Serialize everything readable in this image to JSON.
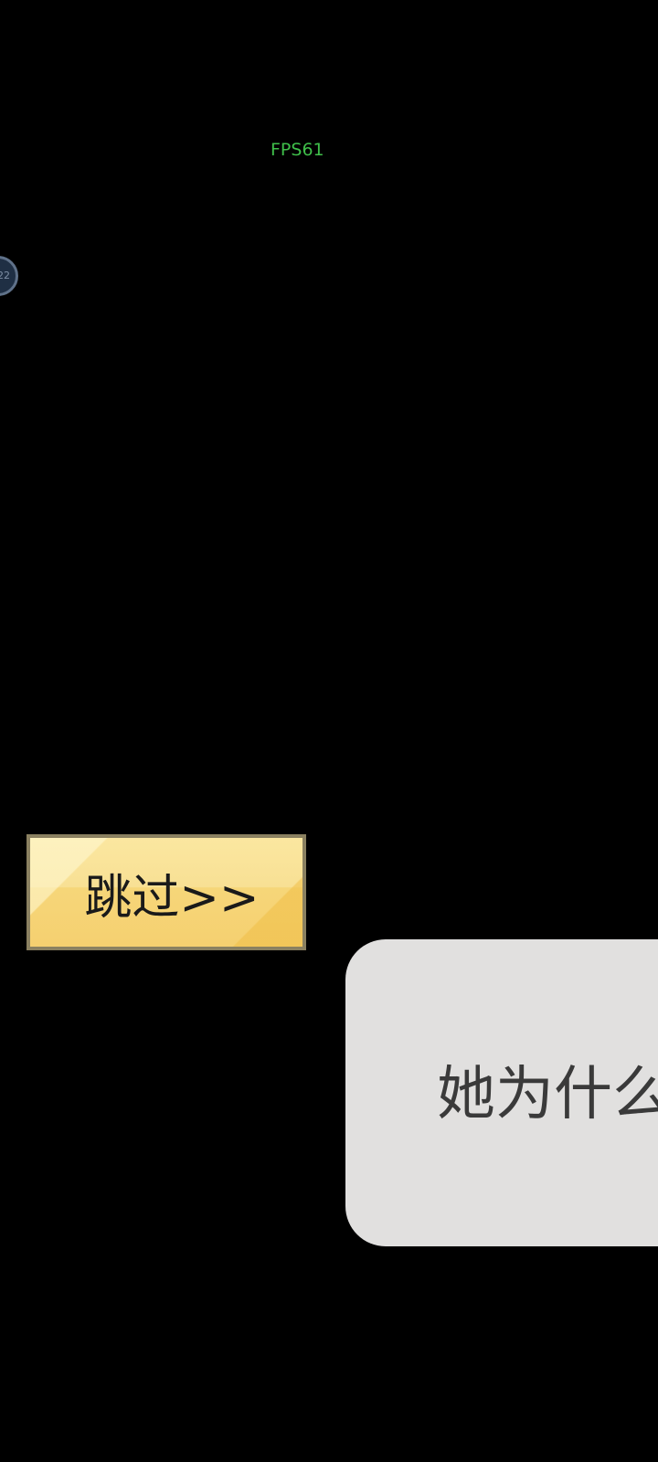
{
  "hud": {
    "fps_text": "FPS61",
    "fps_color": "#3fbf4a"
  },
  "floating_ball": {
    "label": "22"
  },
  "skip_button": {
    "label": "跳过>>"
  },
  "dialog": {
    "text": "她为什么"
  },
  "colors": {
    "background": "#000000",
    "button_gold": "#f8e094",
    "button_border": "#8a8060",
    "dialog_background": "#e1e0df",
    "dialog_text": "#3a3a3a"
  }
}
